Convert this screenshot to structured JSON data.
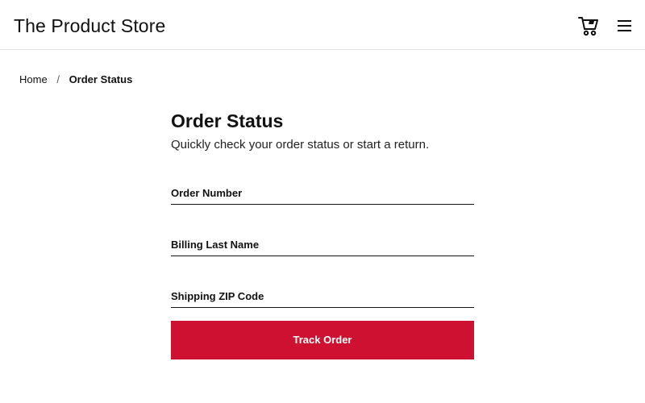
{
  "header": {
    "brand": "The Product Store",
    "cart_icon": "shopping-cart-icon",
    "menu_icon": "hamburger-menu-icon"
  },
  "breadcrumb": {
    "home": "Home",
    "separator": "/",
    "current": "Order Status"
  },
  "main": {
    "title": "Order Status",
    "subtitle": "Quickly check your order status or start a return."
  },
  "form": {
    "order_number": {
      "label": "Order Number",
      "value": ""
    },
    "billing_last_name": {
      "label": "Billing Last Name",
      "value": ""
    },
    "shipping_zip": {
      "label": "Shipping ZIP Code",
      "value": ""
    },
    "submit_label": "Track Order"
  },
  "colors": {
    "accent": "#cf1131",
    "text": "#111111",
    "background": "#ffffff",
    "divider": "#e6e6e6"
  }
}
